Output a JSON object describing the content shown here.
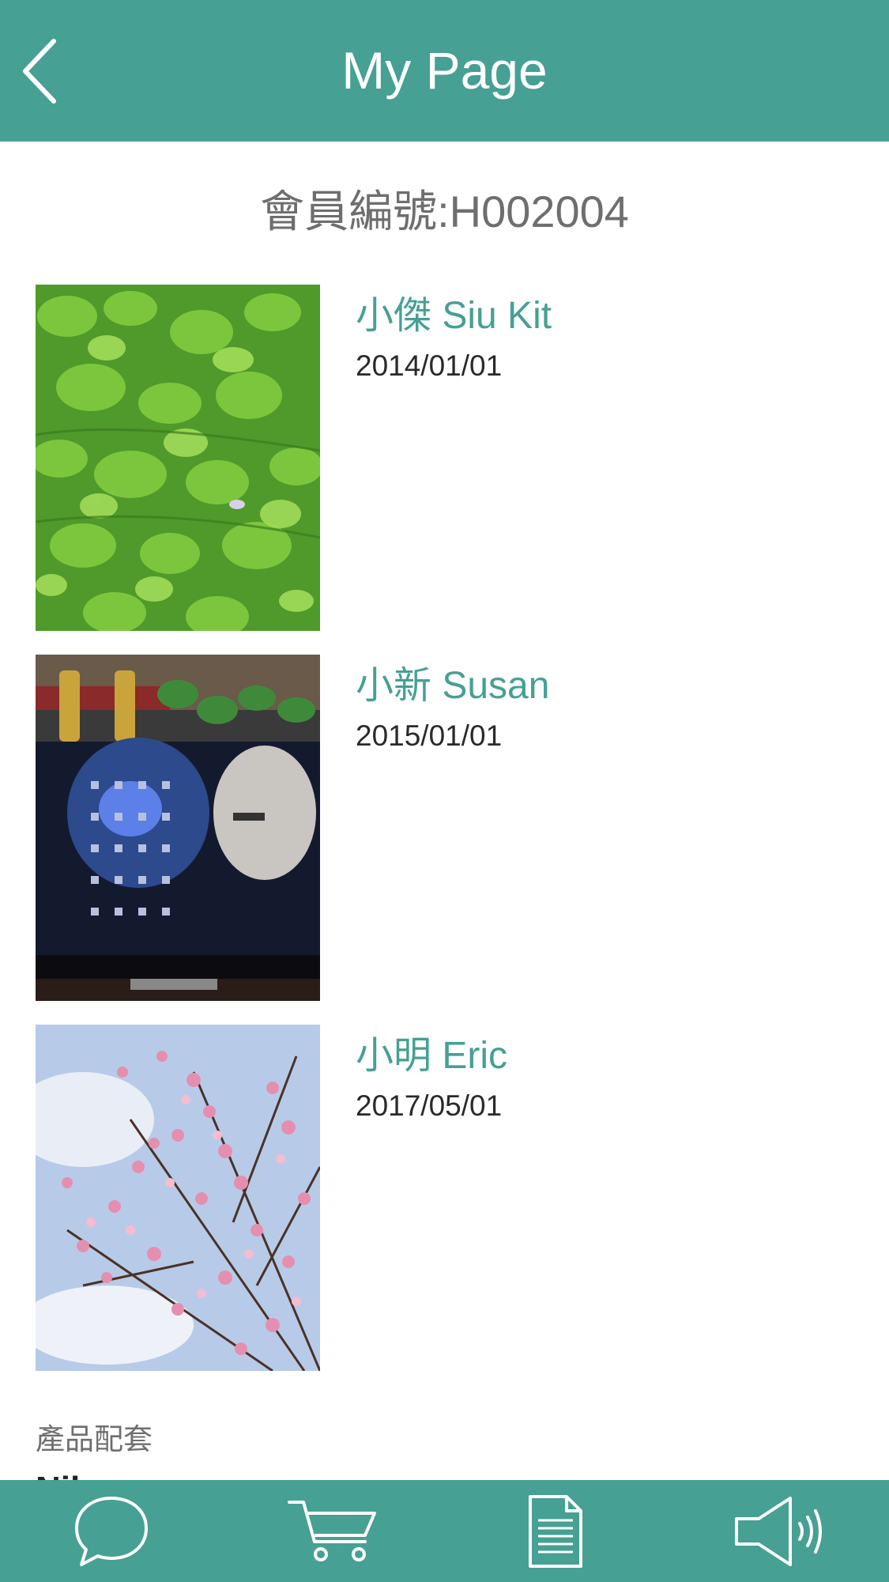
{
  "header": {
    "title": "My Page",
    "back_icon": "chevron-left-icon",
    "background_color": "#46a093"
  },
  "member": {
    "label_id": "會員編號:H002004"
  },
  "profiles": [
    {
      "name": "小傑 Siu Kit",
      "date": "2014/01/01",
      "photo": "green-leaves-photo"
    },
    {
      "name": "小新 Susan",
      "date": "2015/01/01",
      "photo": "desk-monitor-photo"
    },
    {
      "name": "小明 Eric",
      "date": "2017/05/01",
      "photo": "pink-blossoms-photo"
    }
  ],
  "products": {
    "label": "產品配套",
    "value": "Nil"
  },
  "bottom_nav": [
    {
      "icon": "chat-bubble-icon"
    },
    {
      "icon": "cart-icon"
    },
    {
      "icon": "document-icon"
    },
    {
      "icon": "megaphone-icon"
    }
  ],
  "colors": {
    "accent": "#46a093",
    "name_text": "#46a093",
    "muted_text": "#6e6e6e"
  }
}
